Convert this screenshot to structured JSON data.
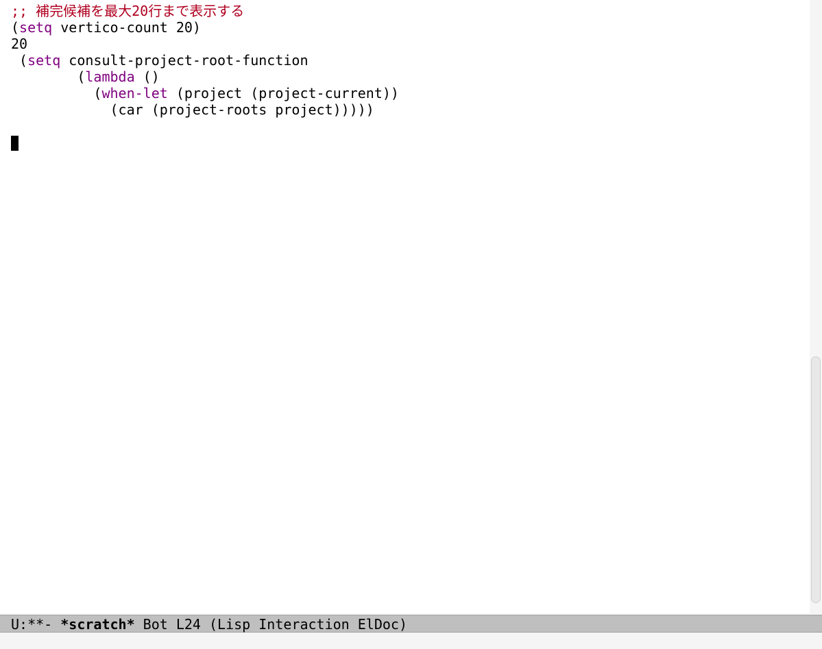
{
  "code": {
    "line1_comment": ";; 補完候補を最大20行まで表示する",
    "line2_open": "(",
    "line2_setq": "setq",
    "line2_rest": " vertico-count 20)",
    "line3": "20",
    "line4": "",
    "line5_indent": " ",
    "line5_open": "(",
    "line5_setq": "setq",
    "line5_rest": " consult-project-root-function",
    "line6_indent": "        ",
    "line6_open": "(",
    "line6_lambda": "lambda",
    "line6_rest": " ()",
    "line7_indent": "          ",
    "line7_open": "(",
    "line7_whenlet": "when-let",
    "line7_rest": " (project (project-current))",
    "line8_indent": "            ",
    "line8_rest": "(car (project-roots project)))))"
  },
  "modeline": {
    "prefix": " U:**-  ",
    "buffer": "*scratch*",
    "middle": "      Bot L24    ",
    "mode": "(Lisp Interaction ElDoc)"
  }
}
